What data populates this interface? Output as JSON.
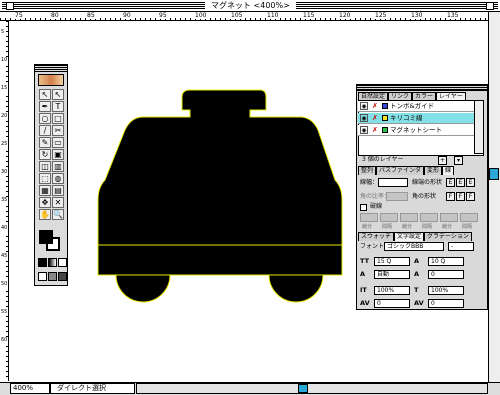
{
  "window": {
    "title": "マグネット <400%>"
  },
  "rulers": {
    "h_labels": [
      "75",
      "80",
      "85",
      "90",
      "95",
      "100",
      "105",
      "110",
      "115",
      "120",
      "125",
      "130",
      "135"
    ],
    "v_labels": [
      "5",
      "10",
      "15",
      "20",
      "25",
      "30",
      "35",
      "40",
      "45",
      "50",
      "55",
      "60"
    ]
  },
  "status": {
    "zoom": "400%",
    "tool": "ダイレクト選択"
  },
  "colors": {
    "accent": "#2aa8d8",
    "shape": "#000000",
    "outline": "#e8e800",
    "selected_layer": "#82e0e6"
  },
  "palette_top": {
    "tabs": [
      "自然設定",
      "リンク",
      "カラー",
      "レイヤー"
    ],
    "layers": [
      {
        "name": "トンボ&ガイド",
        "color": "#3a4adf",
        "selected": false
      },
      {
        "name": "キリコミ線",
        "color": "#f2e02a",
        "selected": true
      },
      {
        "name": "マグネットシート",
        "color": "#2ac24a",
        "selected": false
      }
    ],
    "footer": "3 個のレイヤー"
  },
  "palette_mid": {
    "tabs": [
      "整列",
      "パスファインダ",
      "変形",
      "線"
    ],
    "width_label": "線幅：",
    "cap_label": "線端の形状",
    "corner_label": "角の比率：",
    "join_label": "角の形状",
    "dash_label": "破線",
    "dash_fields": [
      "線分",
      "間隔",
      "線分",
      "間隔",
      "線分",
      "間隔"
    ]
  },
  "palette_bot": {
    "tabs": [
      "スウォッチ",
      "文字設定",
      "グラデーション"
    ],
    "font_label": "フォント：",
    "font_value": "ゴシックBBB",
    "font_style": "-",
    "size": "15 Q",
    "leading": "自動",
    "horiz_scale": "100%",
    "vert_scale": "100%",
    "tracking": "0",
    "kerning": "0",
    "size2": "10 Q",
    "baseline": "0"
  }
}
